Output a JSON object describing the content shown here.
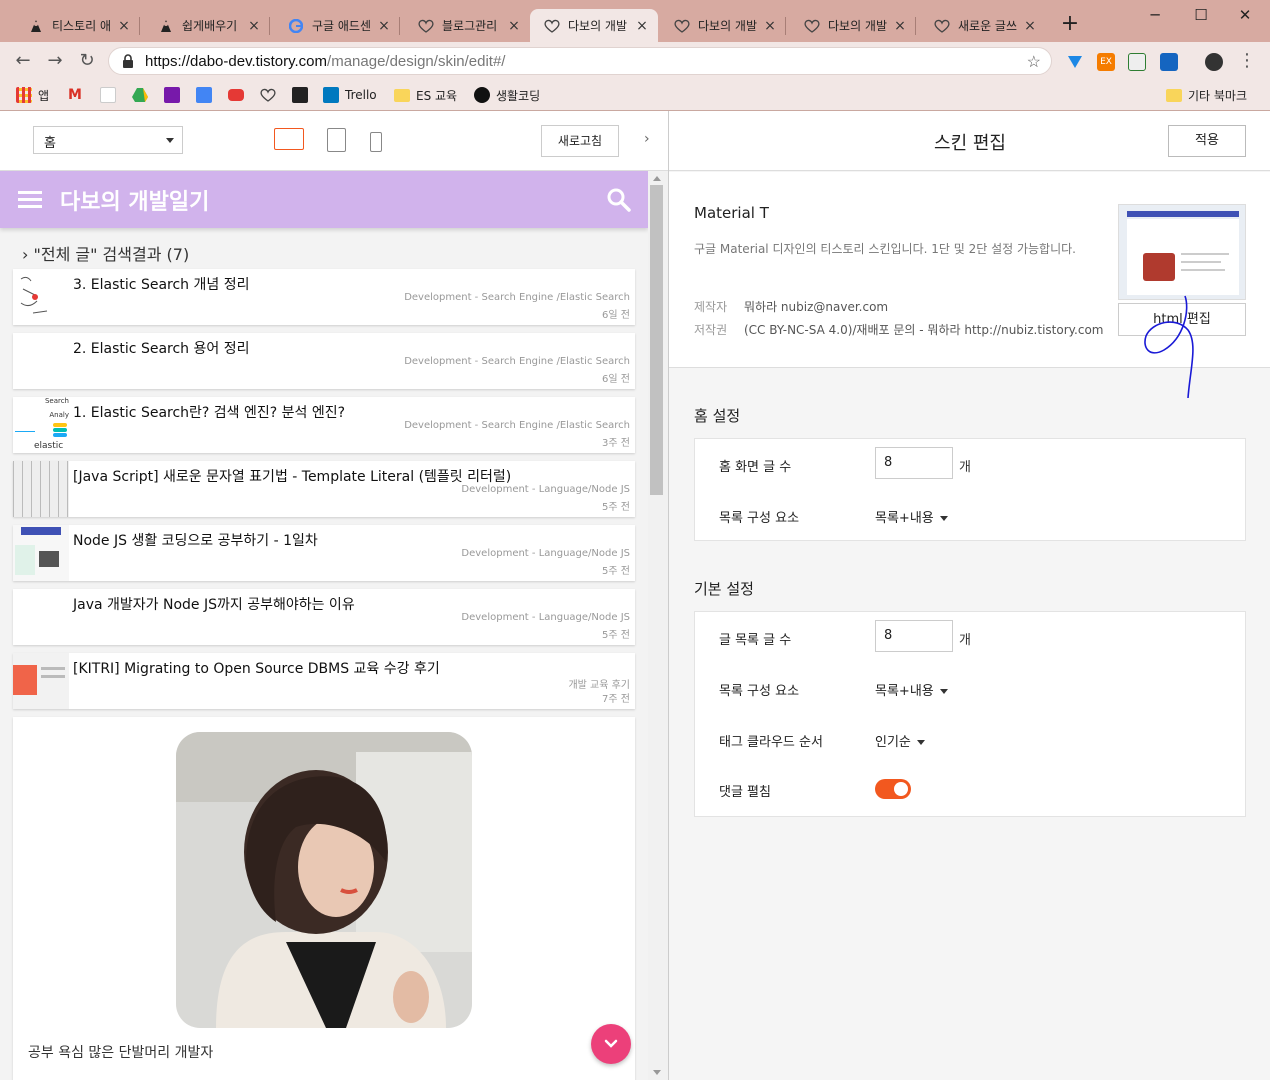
{
  "browser": {
    "tabs": [
      {
        "title": "티스토리 애",
        "icon": "tistory-icon",
        "active": false
      },
      {
        "title": "쉽게배우기",
        "icon": "tistory-icon",
        "active": false
      },
      {
        "title": "구글 애드센",
        "icon": "google-icon",
        "active": false
      },
      {
        "title": "블로그관리",
        "icon": "heart-icon",
        "active": false
      },
      {
        "title": "다보의 개발",
        "icon": "heart-icon",
        "active": true
      },
      {
        "title": "다보의 개발",
        "icon": "heart-icon",
        "active": false
      },
      {
        "title": "다보의 개발",
        "icon": "heart-icon",
        "active": false
      },
      {
        "title": "새로운 글쓰",
        "icon": "heart-icon",
        "active": false
      }
    ],
    "url_host": "https://dabo-dev.tistory.com",
    "url_path": "/manage/design/skin/edit#/",
    "bookmarks": [
      "앱",
      "Trello",
      "ES 교육",
      "생활코딩"
    ],
    "other_bookmarks": "기타 북마크",
    "colors": {
      "tabbar": "#d7aaa1",
      "toolbar": "#f2e7e5"
    }
  },
  "preview": {
    "page_select": "홈",
    "refresh_label": "새로고침",
    "blog_title": "다보의 개발일기",
    "result_label": "\"전체 글\" 검색결과 (7)",
    "posts": [
      {
        "title": "3. Elastic Search 개념 정리",
        "category": "Development - Search Engine /Elastic Search",
        "time": "6일 전"
      },
      {
        "title": "2. Elastic Search 용어 정리",
        "category": "Development - Search Engine /Elastic Search",
        "time": "6일 전"
      },
      {
        "title": "1. Elastic Search란? 검색 엔진? 분석 엔진?",
        "category": "Development - Search Engine /Elastic Search",
        "time": "3주 전"
      },
      {
        "title": "[Java Script] 새로운 문자열 표기법 - Template Literal (템플릿 리터럴)",
        "category": "Development - Language/Node JS",
        "time": "5주 전"
      },
      {
        "title": "Node JS 생활 코딩으로 공부하기 - 1일차",
        "category": "Development - Language/Node JS",
        "time": "5주 전"
      },
      {
        "title": "Java 개발자가 Node JS까지 공부해야하는 이유",
        "category": "Development - Language/Node JS",
        "time": "5주 전"
      },
      {
        "title": "[KITRI] Migrating to Open Source DBMS 교육 수강 후기",
        "category": "개발 교육 후기",
        "time": "7주 전"
      }
    ],
    "thumb_texts": {
      "elastic": "elastic",
      "analy": "Analy",
      "search": "Search"
    },
    "profile_desc": "공부 욕심 많은 단발머리 개발자",
    "colors": {
      "header": "#d1b3ec",
      "fab": "#ec407a"
    }
  },
  "editor": {
    "title": "스킨 편집",
    "apply_label": "적용",
    "skin_name": "Material T",
    "skin_desc": "구글 Material 디자인의 티스토리 스킨입니다. 1단 및 2단 설정 가능합니다.",
    "author_key": "제작자",
    "author_value": "뭐하라 nubiz@naver.com",
    "copyright_key": "저작권",
    "copyright_value": "(CC BY-NC-SA 4.0)/재배포 문의 - 뭐하라 http://nubiz.tistory.com",
    "html_edit_label": "html 편집",
    "home_section": {
      "title": "홈 설정",
      "home_post_count_label": "홈 화면 글 수",
      "home_post_count": "8",
      "unit": "개",
      "list_element_label": "목록 구성 요소",
      "list_element_value": "목록+내용"
    },
    "basic_section": {
      "title": "기본 설정",
      "post_count_label": "글 목록 글 수",
      "post_count": "8",
      "unit": "개",
      "list_element_label": "목록 구성 요소",
      "list_element_value": "목록+내용",
      "tag_order_label": "태그 클라우드 순서",
      "tag_order_value": "인기순",
      "comment_expand_label": "댓글 펼침",
      "comment_expand_on": true
    },
    "colors": {
      "toggle": "#f2581f"
    }
  }
}
